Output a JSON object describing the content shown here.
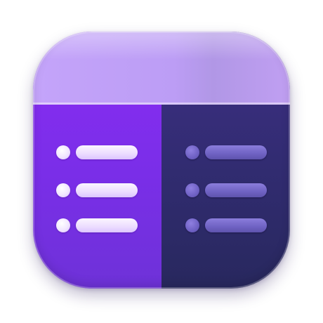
{
  "icon": {
    "name": "list-comparison-app-icon",
    "colors": {
      "header": "#c4a4fa",
      "left_panel": "#8a2cf4",
      "right_panel": "#322c72",
      "left_items": "#f1e6ff",
      "right_items": "#6f61c4"
    },
    "left_column": {
      "items": [
        {
          "icon": "bullet-dot"
        },
        {
          "icon": "bullet-dot"
        },
        {
          "icon": "bullet-dot"
        }
      ]
    },
    "right_column": {
      "items": [
        {
          "icon": "bullet-dot"
        },
        {
          "icon": "bullet-dot"
        },
        {
          "icon": "bullet-dot"
        }
      ]
    }
  }
}
